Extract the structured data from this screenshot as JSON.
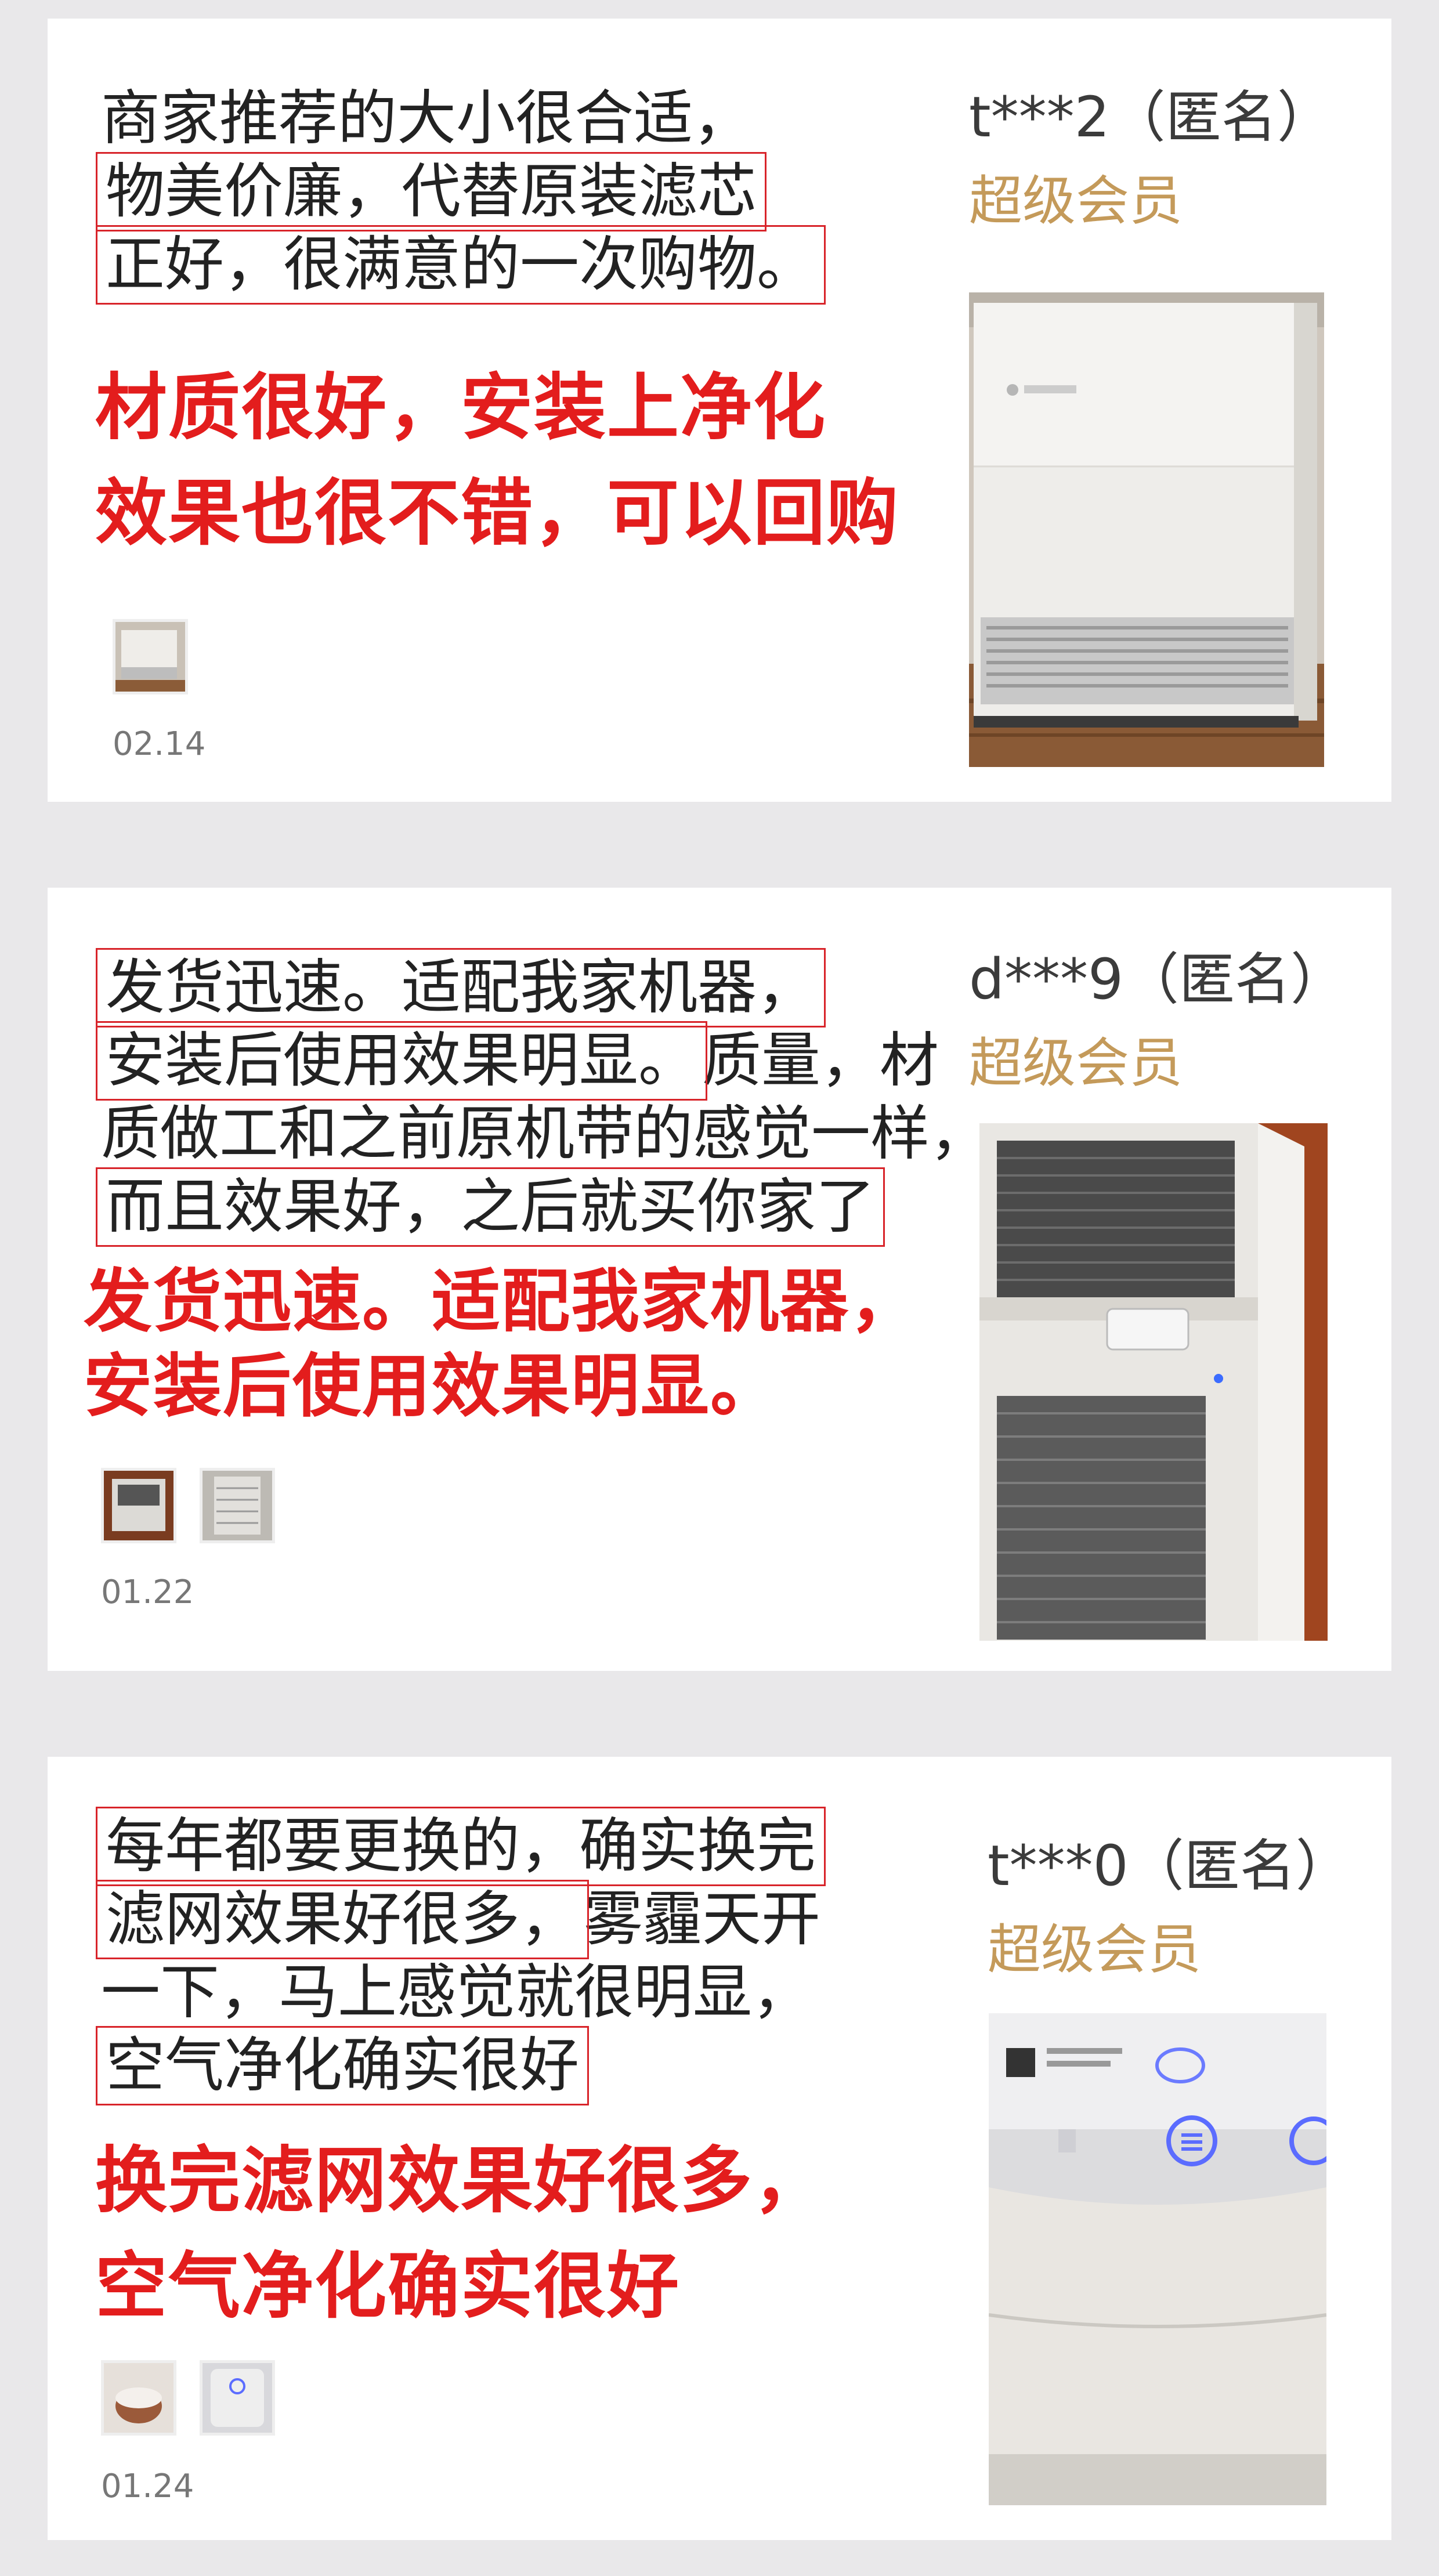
{
  "reviews": [
    {
      "text_lines": [
        "商家推荐的大小很合适，",
        "物美价廉，代替原装滤芯",
        "正好，很满意的一次购物。"
      ],
      "highlight_lines": [
        false,
        true,
        true
      ],
      "quote_lines": [
        "材质很好，安装上净化",
        "效果也很不错，可以回购"
      ],
      "user": "t***2（匿名）",
      "member": "超级会员",
      "date": "02.14",
      "photo_icon": "air-purifier-photo",
      "thumb_icons": [
        "air-purifier-thumbnail"
      ]
    },
    {
      "text_lines": [
        {
          "pre": "发货迅速。适配我家机器，",
          "hl": true,
          "post": ""
        },
        {
          "pre": "安装后使用效果明显。",
          "hl": true,
          "post": "质量，材"
        },
        {
          "pre": "质做工和之前原机带的感觉一样，",
          "hl": false,
          "post": ""
        },
        {
          "pre": "而且效果好，之后就买你家了",
          "hl": true,
          "post": ""
        }
      ],
      "quote_lines": [
        "发货迅速。适配我家机器，",
        "安装后使用效果明显。"
      ],
      "user": "d***9（匿名）",
      "member": "超级会员",
      "date": "01.22",
      "photo_icon": "air-purifier-top-photo",
      "thumb_icons": [
        "purifier-thumbnail-1",
        "filter-thumbnail-2"
      ]
    },
    {
      "text_lines": [
        {
          "pre": "每年都要更换的，确实换完",
          "hl": true,
          "post": ""
        },
        {
          "pre": "滤网效果好很多，",
          "hl": true,
          "post": "雾霾天开"
        },
        {
          "pre": "一下，马上感觉就很明显，",
          "hl": false,
          "post": ""
        },
        {
          "pre": "空气净化确实很好",
          "hl": true,
          "post": ""
        }
      ],
      "quote_lines": [
        "换完滤网效果好很多，",
        "空气净化确实很好"
      ],
      "user": "t***0（匿名）",
      "member": "超级会员",
      "date": "01.24",
      "photo_icon": "purifier-control-panel-photo",
      "thumb_icons": [
        "cup-thumbnail-1",
        "purifier-thumbnail-2"
      ]
    }
  ],
  "colors": {
    "quote": "#e31d1d",
    "member": "#c49a5a",
    "highlight_border": "#d8242a",
    "page_bg": "#e9e8ea"
  }
}
